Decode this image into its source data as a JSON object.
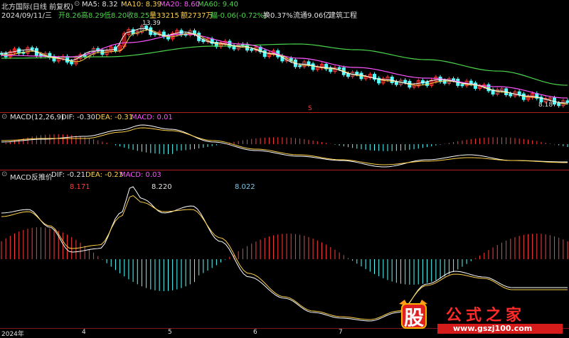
{
  "panel1": {
    "stock": "北方国际(日线 前复权)",
    "ma5": "MA5: 8.32",
    "ma10": "MA10: 8.39",
    "ma20": "MA20: 8.60",
    "ma60": "MA60: 9.40",
    "line2_date": "2024/09/11/三",
    "open": "开8.26",
    "high": "高8.29",
    "low": "低8.20",
    "close": "收8.25",
    "volume": "量33215",
    "amount": "额2737万",
    "change": "幅-0.06(-0.72%)",
    "turnover": "换0.37%",
    "float": "流通9.06亿",
    "industry": "建筑工程",
    "price_high_label": "13.39",
    "price_low_label": "8.18",
    "marker": "S"
  },
  "panel2": {
    "title": "MACD(12,26,9)",
    "dif": "DIF: -0.30",
    "dea": "DEA: -0.31",
    "macd": "MACD: 0.01"
  },
  "panel3": {
    "title": "MACD反推价",
    "dif": "DIF: -0.21",
    "dea": "DEA: -0.23",
    "macd": "MACD: 0.03",
    "val1": "8.171",
    "val2": "8.220",
    "val3": "8.022"
  },
  "xaxis": [
    "2024年",
    "4",
    "5",
    "6",
    "7"
  ],
  "watermark": {
    "char": "股",
    "title": "公式之家",
    "url": "www.gszj100.com"
  },
  "colors": {
    "up": "#ff3c3c",
    "down": "#54ffff",
    "ma5": "#ffffff",
    "ma10": "#ffd24a",
    "ma20": "#ff54ff",
    "ma60": "#4cd44c"
  }
}
